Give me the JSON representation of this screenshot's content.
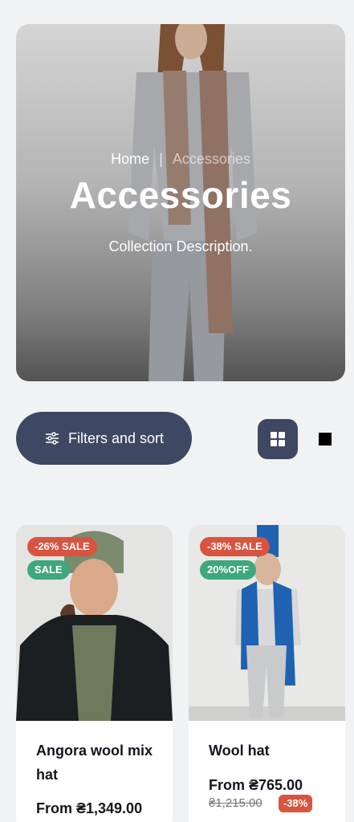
{
  "hero": {
    "breadcrumb_home": "Home",
    "breadcrumb_separator": "|",
    "breadcrumb_current": "Accessories",
    "title": "Accessories",
    "description": "Collection Description."
  },
  "toolbar": {
    "filter_label": "Filters and sort",
    "filter_icon": "sliders-icon",
    "grid_icon": "grid-view-icon",
    "list_icon": "list-view-icon"
  },
  "products": [
    {
      "badge_sale": "-26% SALE",
      "badge_secondary": "SALE",
      "name": "Angora wool mix hat",
      "price": "From ₴1,349.00",
      "old_price": "",
      "discount": ""
    },
    {
      "badge_sale": "-38% SALE",
      "badge_secondary": "20%OFF",
      "name": "Wool hat",
      "price": "From ₴765.00",
      "old_price": "₴1,215.00",
      "discount": "-38%"
    }
  ],
  "colors": {
    "background": "#f0f2f4",
    "accent": "#3e4862",
    "sale_badge": "#d9543f",
    "promo_badge": "#3ea77d"
  }
}
